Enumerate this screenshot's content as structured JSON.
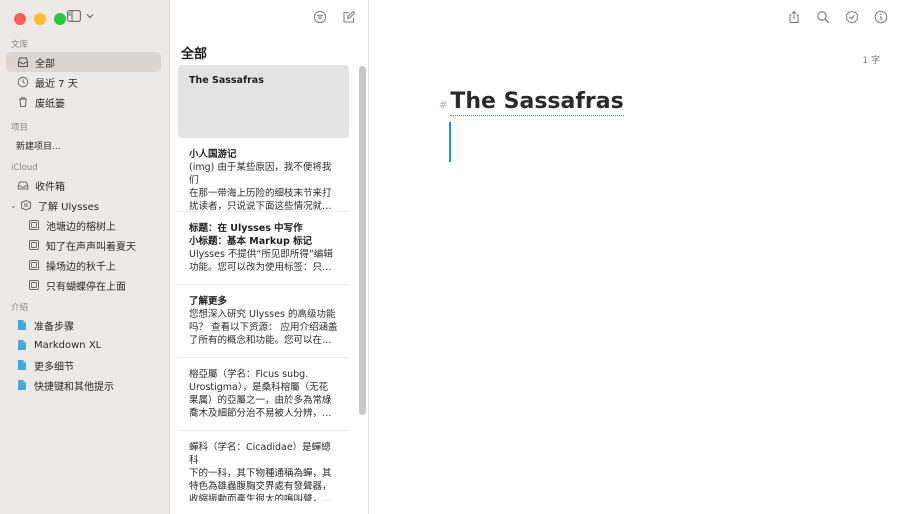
{
  "sidebar": {
    "library_title": "文库",
    "library_items": [
      {
        "label": "全部",
        "icon": "inbox-stack-icon",
        "selected": true
      },
      {
        "label": "最近 7 天",
        "icon": "clock-icon"
      },
      {
        "label": "废纸篓",
        "icon": "trash-icon"
      }
    ],
    "projects_title": "项目",
    "projects_items": [
      {
        "label": "新建项目..."
      }
    ],
    "icloud_title": "iCloud",
    "icloud_items": [
      {
        "label": "收件箱",
        "icon": "tray-icon"
      },
      {
        "label": "了解 Ulysses",
        "icon": "group-icon",
        "expanded": true
      }
    ],
    "icloud_children": [
      {
        "label": "池塘边的榕树上"
      },
      {
        "label": "知了在声声叫着夏天"
      },
      {
        "label": "操场边的秋千上"
      },
      {
        "label": "只有蝴蝶停在上面"
      }
    ],
    "intro_title": "介绍",
    "intro_items": [
      {
        "label": "准备步骤"
      },
      {
        "label": "Markdown XL"
      },
      {
        "label": "更多细节"
      },
      {
        "label": "快捷键和其他提示"
      }
    ]
  },
  "list": {
    "heading": "全部",
    "sheets": [
      {
        "title": "The Sassafras",
        "lines": [],
        "selected": true
      },
      {
        "title": "小人国游记",
        "lines": [
          "(img) 由于某些原因，我不便将我们",
          "在那一带海上历险的细枝末节来打",
          "扰读者，只说说下面这些情况就…"
        ]
      },
      {
        "title": "标题：在 Ulysses 中写作",
        "title2": "小标题：基本 Markup 标记",
        "lines": [
          "Ulysses 不提供“所见即所得”编辑",
          "功能。您可以改为使用标签：只…"
        ]
      },
      {
        "title": "了解更多",
        "lines": [
          "您想深入研究 Ulysses 的高级功能",
          "吗？ 查看以下资源： 应用介绍涵盖",
          "了所有的概念和功能。您可以在…"
        ]
      },
      {
        "title": "",
        "lines": [
          "榕亞屬（学名：Ficus subg.",
          "Urostigma），是桑科榕屬（无花",
          "果属）的亞屬之一，由於多為常綠",
          "喬木及細節分治不易被人分辨，…"
        ]
      },
      {
        "title": "",
        "lines": [
          "蟬科（学名：Cicadidae）是蟬總科",
          "下的一科，其下物種通稱為蟬，其",
          "特色為雄蟲腹胸交界處有發聲器，",
          "收縮振動而產生很大的鳴叫聲，…"
        ]
      }
    ]
  },
  "editor": {
    "word_count": "1 字",
    "heading_marker": "#",
    "title": "The Sassafras"
  },
  "colors": {
    "sidebar_bg": "#ece9e6",
    "selected_bg": "#dcd6d2",
    "caret": "#2a8fd0",
    "sheet_icon": "#4aa8d8"
  }
}
